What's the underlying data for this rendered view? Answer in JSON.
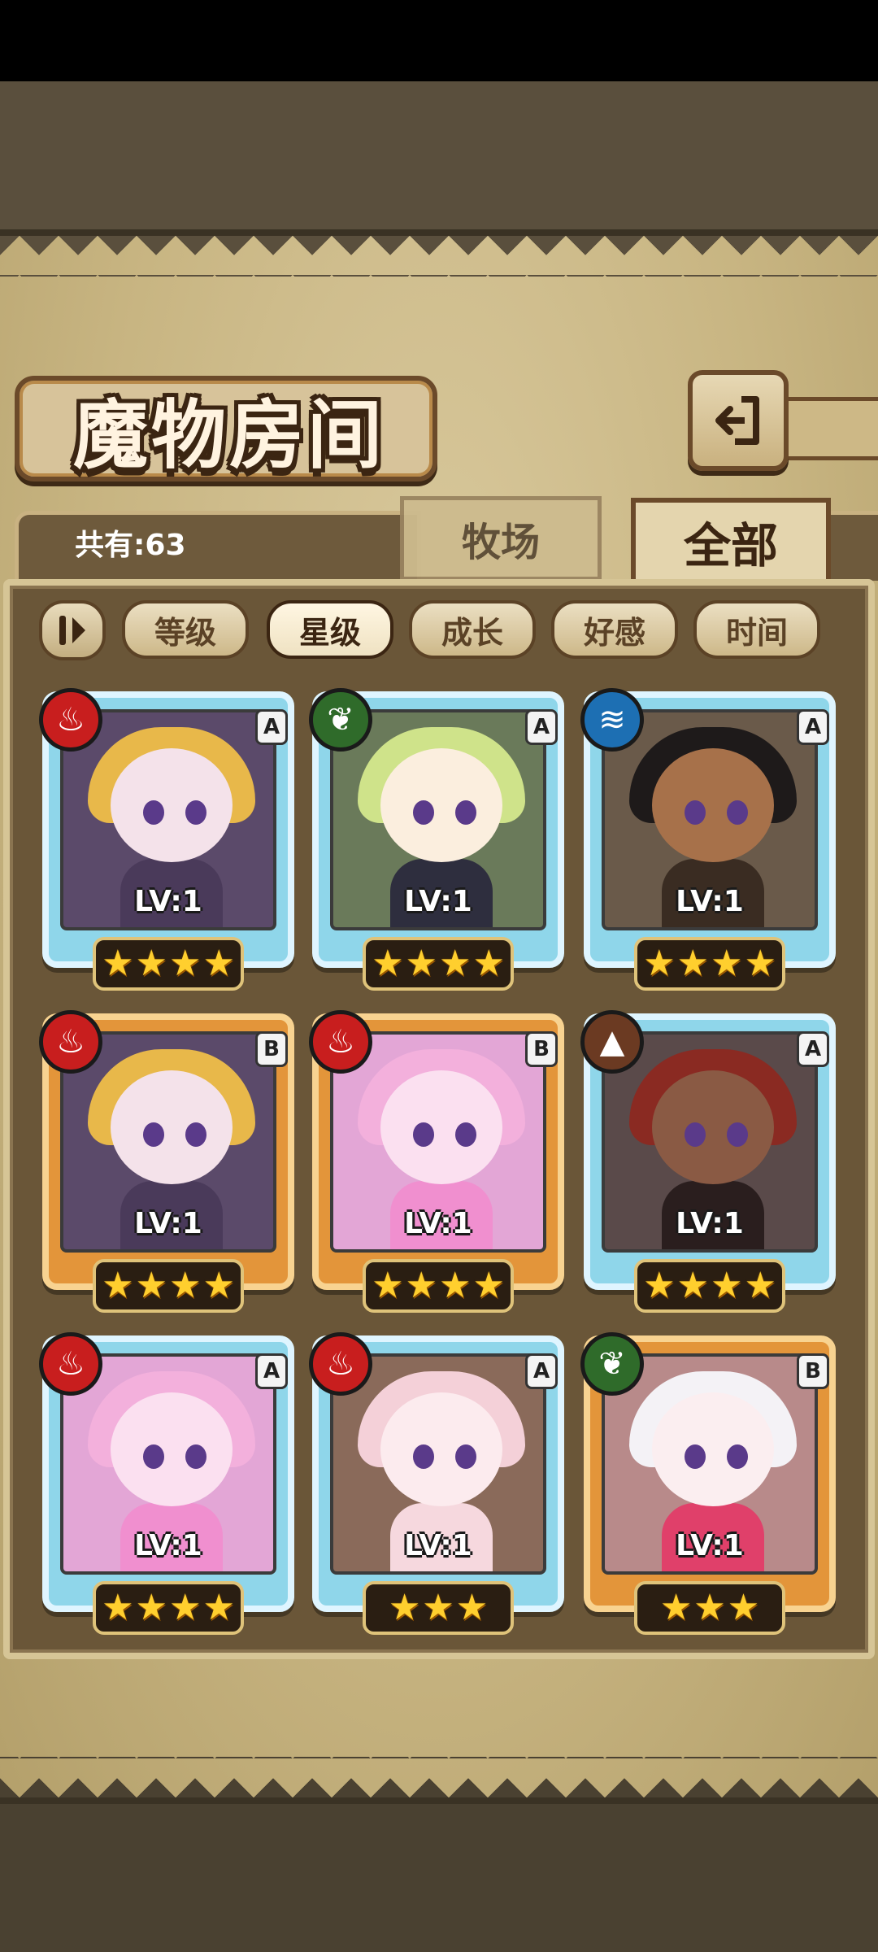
{
  "title": "魔物房间",
  "owned_count": "共有:63",
  "tabs": [
    {
      "label": "牧场",
      "active": false
    },
    {
      "label": "全部",
      "active": true
    }
  ],
  "sort_filters": [
    {
      "label": "等级",
      "active": false
    },
    {
      "label": "星级",
      "active": true
    },
    {
      "label": "成长",
      "active": false
    },
    {
      "label": "好感",
      "active": false
    },
    {
      "label": "时间",
      "active": false
    }
  ],
  "icons": {
    "back": "back-arrow-icon",
    "sort_order": "sort-order-toggle-icon"
  },
  "monsters": [
    {
      "rank": "A",
      "element": "fire",
      "level": "LV:1",
      "stars": 4
    },
    {
      "rank": "A",
      "element": "nature",
      "level": "LV:1",
      "stars": 4
    },
    {
      "rank": "A",
      "element": "water",
      "level": "LV:1",
      "stars": 4
    },
    {
      "rank": "B",
      "element": "fire",
      "level": "LV:1",
      "stars": 4
    },
    {
      "rank": "B",
      "element": "fire",
      "level": "LV:1",
      "stars": 4
    },
    {
      "rank": "A",
      "element": "earth",
      "level": "LV:1",
      "stars": 4
    },
    {
      "rank": "A",
      "element": "fire",
      "level": "LV:1",
      "stars": 4
    },
    {
      "rank": "A",
      "element": "fire",
      "level": "LV:1",
      "stars": 3
    },
    {
      "rank": "B",
      "element": "nature",
      "level": "LV:1",
      "stars": 3
    }
  ],
  "colors": {
    "rank_A_frame": "#8fd6ea",
    "rank_B_frame": "#e3953a",
    "fire": "#c81e1e",
    "nature": "#2f6b2a",
    "water": "#1d6fb3",
    "earth": "#6b3a22",
    "star": "#ffcf2e"
  }
}
